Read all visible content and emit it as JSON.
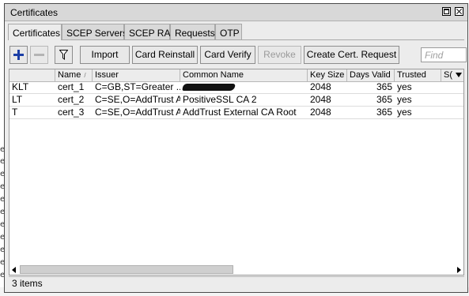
{
  "window": {
    "title": "Certificates"
  },
  "tabs": [
    {
      "label": "Certificates",
      "active": true
    },
    {
      "label": "SCEP Servers",
      "active": false
    },
    {
      "label": "SCEP RA",
      "active": false
    },
    {
      "label": "Requests",
      "active": false
    },
    {
      "label": "OTP",
      "active": false
    }
  ],
  "toolbar": {
    "add_icon": "plus-icon",
    "remove_icon": "minus-icon",
    "filter_icon": "funnel-icon",
    "import_label": "Import",
    "card_reinstall_label": "Card Reinstall",
    "card_verify_label": "Card Verify",
    "revoke_label": "Revoke",
    "create_request_label": "Create Cert. Request",
    "find_placeholder": "Find"
  },
  "table": {
    "columns": [
      "",
      "Name",
      "Issuer",
      "Common Name",
      "Key Size",
      "Days Valid",
      "Trusted",
      "S("
    ],
    "rows": [
      {
        "flags": "KLT",
        "name": "cert_1",
        "issuer": "C=GB,ST=Greater ...",
        "common_name": "",
        "key_size": "2048",
        "days_valid": "365",
        "trusted": "yes"
      },
      {
        "flags": "LT",
        "name": "cert_2",
        "issuer": "C=SE,O=AddTrust A...",
        "common_name": "PositiveSSL CA 2",
        "key_size": "2048",
        "days_valid": "365",
        "trusted": "yes"
      },
      {
        "flags": "T",
        "name": "cert_3",
        "issuer": "C=SE,O=AddTrust A...",
        "common_name": "AddTrust External CA Root",
        "key_size": "2048",
        "days_valid": "365",
        "trusted": "yes"
      }
    ]
  },
  "status": {
    "items_text": "3 items"
  },
  "colors": {
    "accent": "#1b3ea6",
    "window_bg": "#ececec",
    "border": "#9c9c9c"
  }
}
